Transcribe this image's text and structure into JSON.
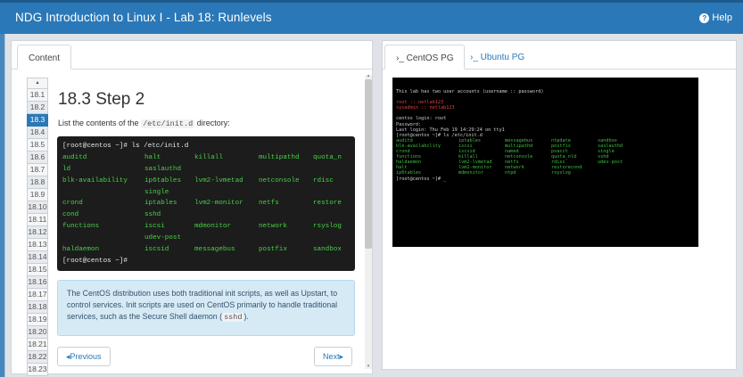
{
  "app": {
    "title": "NDG Introduction to Linux I - Lab 18: Runlevels",
    "help_label": "Help",
    "help_icon": "question-circle-icon"
  },
  "left_panel": {
    "tab": "Content",
    "step_nav_up": "▴",
    "steps": [
      "18.1",
      "18.2",
      "18.3",
      "18.4",
      "18.5",
      "18.6",
      "18.7",
      "18.8",
      "18.9",
      "18.10",
      "18.11",
      "18.12",
      "18.13",
      "18.14",
      "18.15",
      "18.16",
      "18.17",
      "18.18",
      "18.19",
      "18.20",
      "18.21",
      "18.22",
      "18.23"
    ],
    "current_step": "18.3",
    "title": "18.3 Step 2",
    "instruction_before": "List the contents of the",
    "instruction_code": "/etc/init.d",
    "instruction_after": "directory:",
    "terminal": {
      "prompt_command": "[root@centos ~]# ls /etc/init.d",
      "rows": [
        [
          "auditd",
          "halt",
          "killall",
          "multipathd",
          "quota_n"
        ],
        [
          "ld",
          "saslauthd",
          "",
          "",
          ""
        ],
        [
          "blk-availability",
          "ip6tables",
          "lvm2-lvmetad",
          "netconsole",
          "rdisc"
        ],
        [
          "",
          "single",
          "",
          "",
          ""
        ],
        [
          "crond",
          "iptables",
          "lvm2-monitor",
          "netfs",
          "restore"
        ],
        [
          "cond",
          "sshd",
          "",
          "",
          ""
        ],
        [
          "functions",
          "iscsi",
          "mdmonitor",
          "network",
          "rsyslog"
        ],
        [
          "",
          "udev-post",
          "",
          "",
          ""
        ],
        [
          "haldaemon",
          "iscsid",
          "messagebus",
          "postfix",
          "sandbox"
        ]
      ],
      "final_prompt": "[root@centos ~]#"
    },
    "info_text_1": "The CentOS distribution uses both traditional init scripts, as well as Upstart, to control services. Init scripts are used on CentOS primarily to handle traditional services, such as the Secure Shell daemon (",
    "info_code": "sshd",
    "info_text_2": ").",
    "prev_label": "◂Previous",
    "next_label": "Next▸"
  },
  "right_panel": {
    "tabs": [
      "›_ CentOS PG",
      "›_ Ubuntu PG"
    ],
    "active_tab": 0,
    "vm": {
      "banner": "This lab has two user accounts (username :: password)",
      "account_1": "root :: netlab123",
      "account_2": "sysadmin :: netlab123",
      "login": "centos login: root",
      "password": "Password:",
      "last_login": "Last login: Thu Feb 19 14:29:24 on tty1",
      "command": "[root@centos ~]# ls /etc/init.d",
      "rows": [
        [
          "auditd",
          "iptables",
          "messagebus",
          "ntpdate",
          "sandbox"
        ],
        [
          "blk-availability",
          "iscsi",
          "multipathd",
          "postfix",
          "saslauthd"
        ],
        [
          "crond",
          "iscsid",
          "named",
          "psacct",
          "single"
        ],
        [
          "functions",
          "killall",
          "netconsole",
          "quota_nld",
          "sshd"
        ],
        [
          "haldaemon",
          "lvm2-lvmetad",
          "netfs",
          "rdisc",
          "udev-post"
        ],
        [
          "halt",
          "lvm2-monitor",
          "network",
          "restorecond",
          ""
        ],
        [
          "ip6tables",
          "mdmonitor",
          "ntpd",
          "rsyslog",
          ""
        ]
      ],
      "final_prompt": "[root@centos ~]# _"
    }
  }
}
